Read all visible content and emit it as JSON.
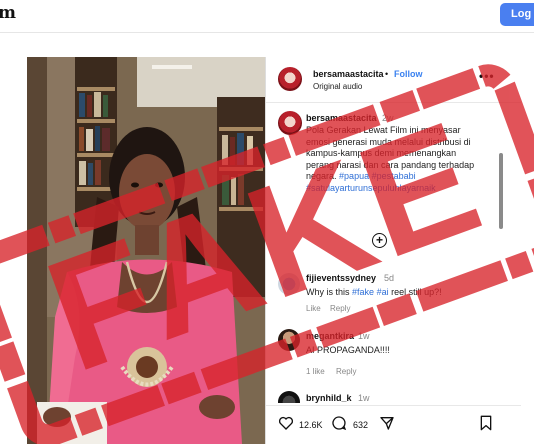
{
  "brand": {
    "logo_text": "m",
    "login_label": "Log"
  },
  "post": {
    "username": "bersamaastacita",
    "follow_label": "Follow",
    "separator": "•",
    "audio_label": "Original audio",
    "more_label": "•••",
    "caption": {
      "username": "bersamaastacita",
      "time": "2w",
      "text": "Pola Gerakan Lewat Film ini menyasar emosi generasi muda melalui distribusi di kampus-kampus demi memenangkan perang narasi dan cara pandang terhadap negara.",
      "hashtags": [
        "#papua",
        "#pestababi",
        "#satulayarturunsepuluhlayarnaik"
      ]
    },
    "comments": [
      {
        "username": "fijieventssydney",
        "time": "5d",
        "text_prefix": "Why is this ",
        "tags": [
          "#fake",
          "#ai"
        ],
        "text_suffix": " reel still up?!",
        "meta": [
          "Like",
          "Reply"
        ]
      },
      {
        "username": "megantkira",
        "time": "1w",
        "text": "AI PROPAGANDA!!!!",
        "meta": [
          "1 like",
          "Reply"
        ]
      },
      {
        "username": "brynhild_k",
        "time": "1w"
      }
    ],
    "likes_count": "12.6K",
    "comments_count": "632"
  },
  "stamp": {
    "text": "FAKE",
    "color": "#d8232a"
  },
  "icons": [
    "heart-icon",
    "comment-icon",
    "share-icon",
    "bookmark-icon",
    "add-comment-icon",
    "more-icon"
  ]
}
